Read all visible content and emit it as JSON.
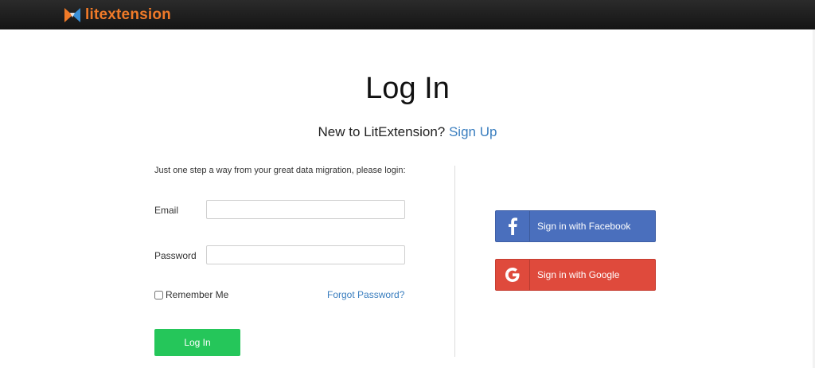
{
  "header": {
    "logo_text": "litextension",
    "logo_icon": "litextension-bowtie-logo"
  },
  "page": {
    "title": "Log In",
    "new_prompt": "New to LitExtension?",
    "signup_link": "Sign Up"
  },
  "form": {
    "intro": "Just one step a way from your great data migration, please login:",
    "email_label": "Email",
    "email_value": "",
    "password_label": "Password",
    "password_value": "",
    "remember_label": "Remember Me",
    "remember_checked": false,
    "forgot_link": "Forgot Password?",
    "login_button": "Log In"
  },
  "social": {
    "facebook_label": "Sign in with Facebook",
    "facebook_icon": "facebook-icon",
    "google_label": "Sign in with Google",
    "google_icon": "google-icon"
  },
  "colors": {
    "brand_orange": "#f07a28",
    "link_blue": "#3a7ebf",
    "login_green": "#25c65a",
    "facebook_blue": "#4a6fbd",
    "google_red": "#df4a3c"
  }
}
